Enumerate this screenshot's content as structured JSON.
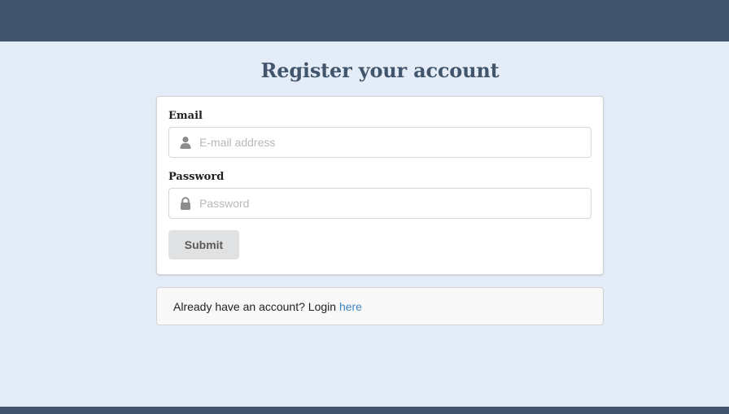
{
  "page": {
    "title": "Register your account"
  },
  "form": {
    "email_label": "Email",
    "email_placeholder": "E-mail address",
    "email_icon": "user-icon",
    "password_label": "Password",
    "password_placeholder": "Password",
    "password_icon": "lock-icon",
    "submit_label": "Submit"
  },
  "footer_message": {
    "text": "Already have an account? Login ",
    "link_label": "here"
  },
  "colors": {
    "header_bar": "#41556c",
    "background": "#e4edf7",
    "title": "#41556c",
    "link": "#4183c4",
    "button": "#e0e1e2"
  }
}
